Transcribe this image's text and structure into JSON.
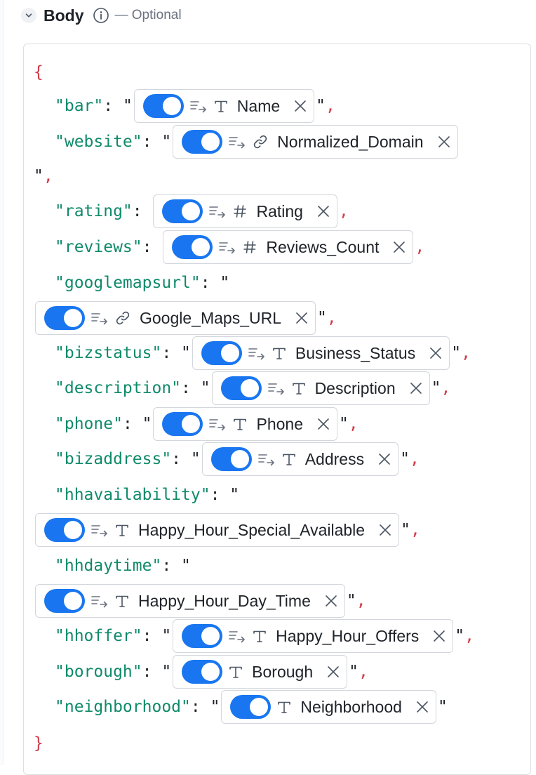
{
  "header": {
    "title": "Body",
    "optional": "— Optional"
  },
  "body": {
    "open_brace": "{",
    "close_brace": "}",
    "fields": [
      {
        "key": "\"bar\"",
        "label": "Name",
        "type": "text",
        "mapped": true,
        "quoted": true,
        "trailing_comma": true
      },
      {
        "key": "\"website\"",
        "label": "Normalized_Domain",
        "type": "link",
        "mapped": true,
        "quoted": true,
        "trailing_comma": true
      },
      {
        "key": "\"rating\"",
        "label": "Rating",
        "type": "number",
        "mapped": true,
        "quoted": false,
        "trailing_comma": true
      },
      {
        "key": "\"reviews\"",
        "label": "Reviews_Count",
        "type": "number",
        "mapped": true,
        "quoted": false,
        "trailing_comma": true
      },
      {
        "key": "\"googlemapsurl\"",
        "label": "Google_Maps_URL",
        "type": "link",
        "mapped": true,
        "quoted": true,
        "trailing_comma": true
      },
      {
        "key": "\"bizstatus\"",
        "label": "Business_Status",
        "type": "text",
        "mapped": true,
        "quoted": true,
        "trailing_comma": true
      },
      {
        "key": "\"description\"",
        "label": "Description",
        "type": "text",
        "mapped": true,
        "quoted": true,
        "trailing_comma": true
      },
      {
        "key": "\"phone\"",
        "label": "Phone",
        "type": "text",
        "mapped": true,
        "quoted": true,
        "trailing_comma": true
      },
      {
        "key": "\"bizaddress\"",
        "label": "Address",
        "type": "text",
        "mapped": true,
        "quoted": true,
        "trailing_comma": true
      },
      {
        "key": "\"hhavailability\"",
        "label": "Happy_Hour_Special_Available",
        "type": "text",
        "mapped": true,
        "quoted": true,
        "trailing_comma": true
      },
      {
        "key": "\"hhdaytime\"",
        "label": "Happy_Hour_Day_Time",
        "type": "text",
        "mapped": true,
        "quoted": true,
        "trailing_comma": true
      },
      {
        "key": "\"hhoffer\"",
        "label": "Happy_Hour_Offers",
        "type": "text",
        "mapped": true,
        "quoted": true,
        "trailing_comma": true
      },
      {
        "key": "\"borough\"",
        "label": "Borough",
        "type": "text",
        "mapped": false,
        "quoted": true,
        "trailing_comma": true
      },
      {
        "key": "\"neighborhood\"",
        "label": "Neighborhood",
        "type": "text",
        "mapped": false,
        "quoted": true,
        "trailing_comma": false
      }
    ]
  },
  "colors": {
    "toggle_on": "#1976f0",
    "json_key": "#0f8a6a",
    "json_punctuation": "#d23b4a"
  },
  "icons": {
    "toggle": "toggle-on-icon",
    "mapping": "list-arrow-icon",
    "text": "text-type-icon",
    "link": "link-icon",
    "number": "hash-icon",
    "remove": "close-icon"
  }
}
